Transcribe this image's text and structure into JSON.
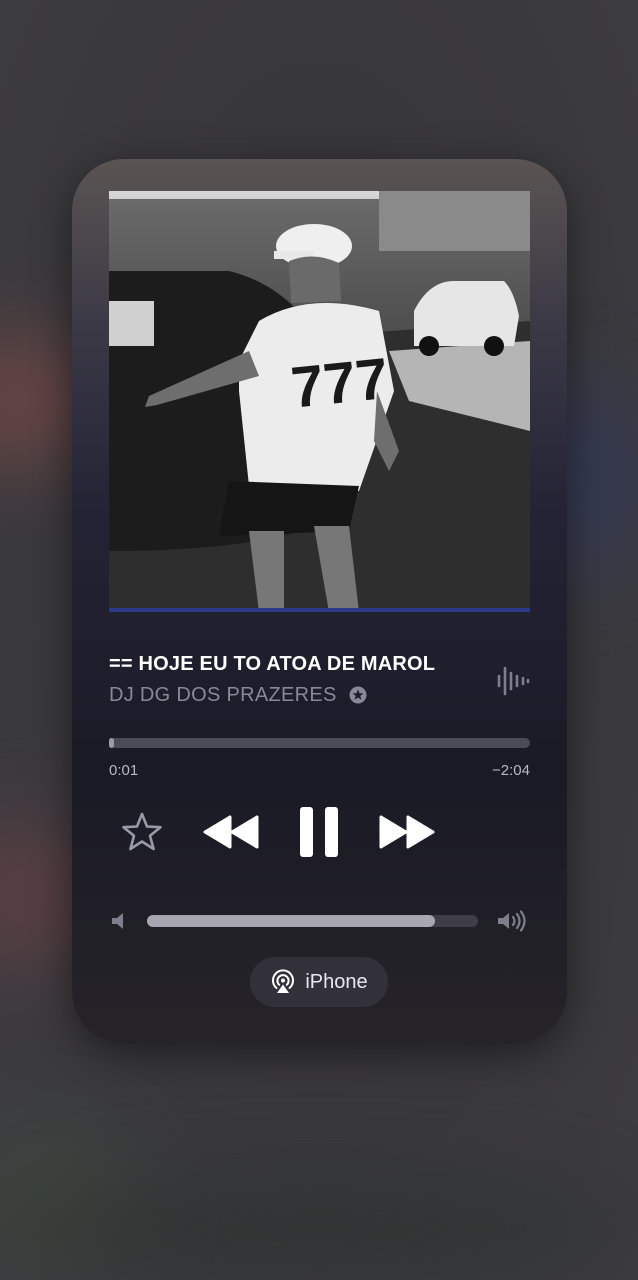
{
  "now_playing": {
    "title": "== HOJE EU TO ATOA DE MAROL",
    "artist": "DJ DG DOS PRAZERES",
    "artwork_jersey_number": "777",
    "elapsed": "0:01",
    "remaining": "−2:04",
    "progress_fraction": 0.01
  },
  "controls": {
    "favorite_icon": "star-outline-icon",
    "rewind_icon": "backward-icon",
    "play_pause_icon": "pause-icon",
    "forward_icon": "forward-icon"
  },
  "volume": {
    "level_fraction": 0.87,
    "low_icon": "speaker-low-icon",
    "high_icon": "speaker-high-icon"
  },
  "output": {
    "device_label": "iPhone",
    "icon": "airplay-audio-icon"
  },
  "colors": {
    "accent_text": "#ffffff",
    "secondary_text": "#8a8896"
  }
}
